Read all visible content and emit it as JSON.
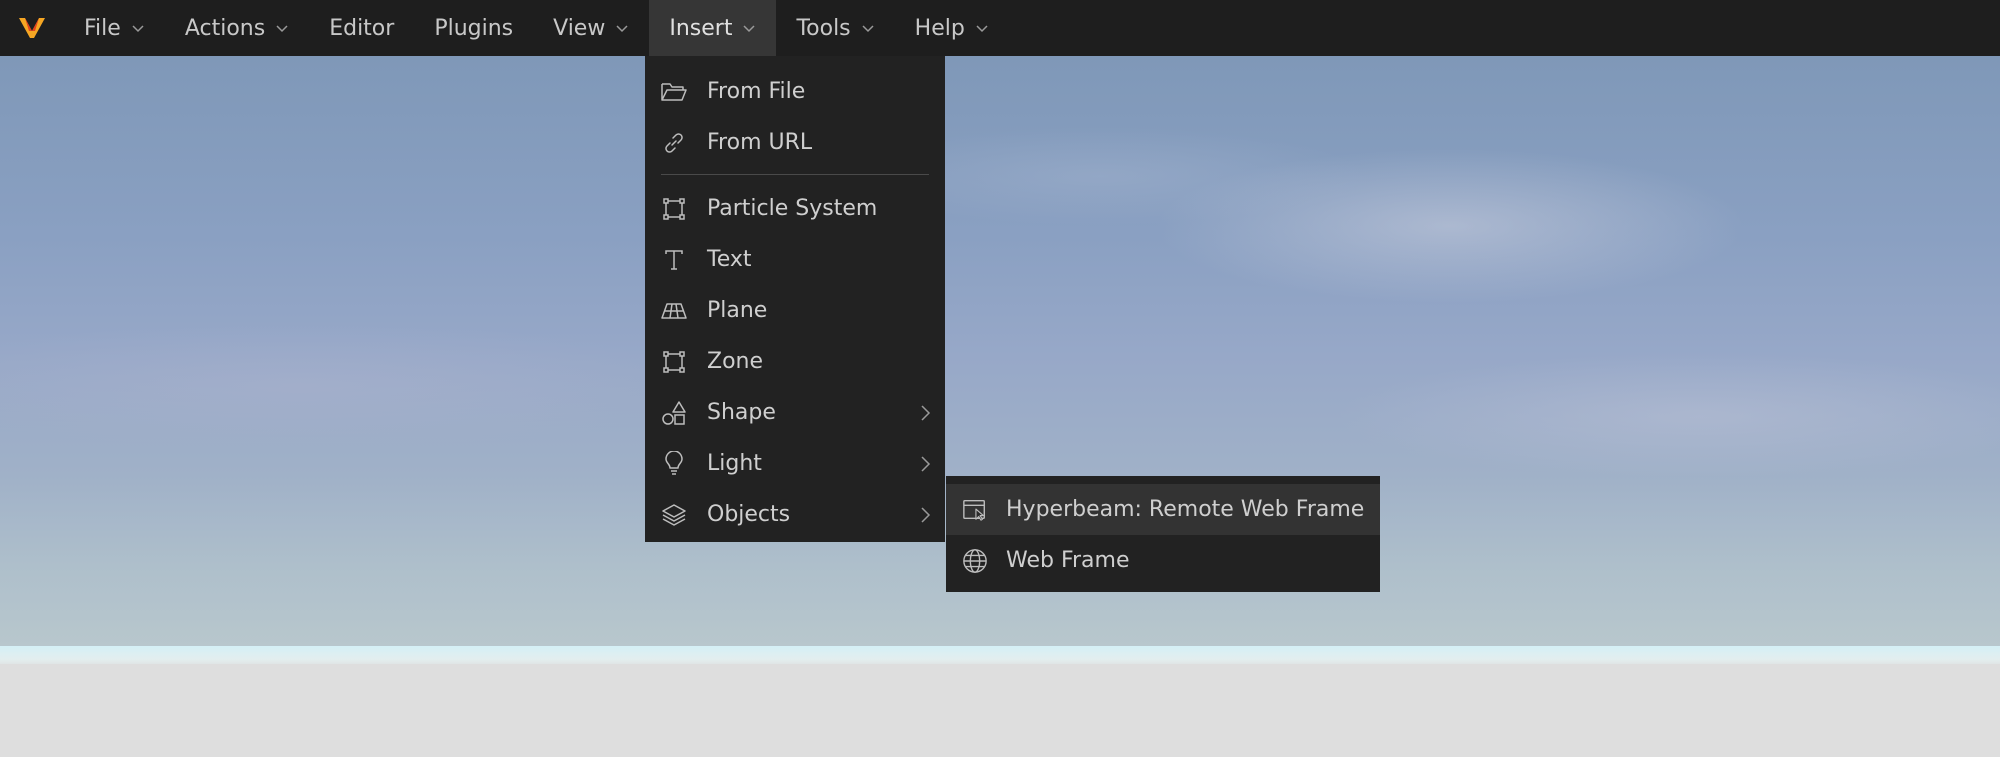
{
  "menubar": {
    "logo": "v-logo-icon",
    "items": [
      {
        "label": "File",
        "has_dropdown": true
      },
      {
        "label": "Actions",
        "has_dropdown": true
      },
      {
        "label": "Editor",
        "has_dropdown": false
      },
      {
        "label": "Plugins",
        "has_dropdown": false
      },
      {
        "label": "View",
        "has_dropdown": true
      },
      {
        "label": "Insert",
        "has_dropdown": true,
        "active": true
      },
      {
        "label": "Tools",
        "has_dropdown": true
      },
      {
        "label": "Help",
        "has_dropdown": true
      }
    ]
  },
  "insert_menu": {
    "items": [
      {
        "label": "From File",
        "icon": "folder-open-icon"
      },
      {
        "label": "From URL",
        "icon": "link-icon"
      },
      {
        "label": "Particle System",
        "icon": "bounding-box-icon"
      },
      {
        "label": "Text",
        "icon": "text-icon"
      },
      {
        "label": "Plane",
        "icon": "plane-grid-icon"
      },
      {
        "label": "Zone",
        "icon": "bounding-box-icon"
      },
      {
        "label": "Shape",
        "icon": "shapes-icon",
        "submenu": true
      },
      {
        "label": "Light",
        "icon": "lightbulb-icon",
        "submenu": true
      },
      {
        "label": "Objects",
        "icon": "layers-icon",
        "submenu": true,
        "open": true
      }
    ]
  },
  "objects_submenu": {
    "items": [
      {
        "label": "Hyperbeam: Remote Web Frame",
        "icon": "web-window-cursor-icon",
        "highlighted": true
      },
      {
        "label": "Web Frame",
        "icon": "globe-icon"
      }
    ]
  },
  "colors": {
    "menubar_bg": "#1e1e1e",
    "menu_bg": "#222222",
    "active_bg": "#363636",
    "text": "#cfcfcf",
    "logo_orange": "#f5a623"
  }
}
